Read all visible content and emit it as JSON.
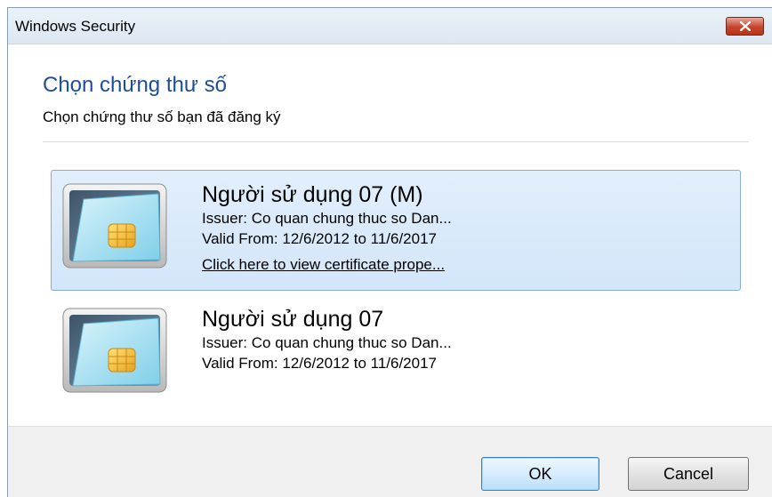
{
  "window": {
    "title": "Windows Security",
    "close_icon": "close-x-icon"
  },
  "dialog": {
    "heading": "Chọn chứng thư số",
    "subheading": "Chọn chứng thư số bạn đã đăng ký"
  },
  "certificates": [
    {
      "name": "Người sử dụng 07 (M)",
      "issuer": "Issuer: Co quan chung thuc so Dan...",
      "valid": "Valid From: 12/6/2012 to 11/6/2017",
      "link": "Click here to view certificate prope...",
      "selected": true,
      "icon": "smart-card-icon"
    },
    {
      "name": "Người sử dụng 07",
      "issuer": "Issuer: Co quan chung thuc so Dan...",
      "valid": "Valid From: 12/6/2012 to 11/6/2017",
      "selected": false,
      "icon": "smart-card-icon"
    }
  ],
  "buttons": {
    "ok": "OK",
    "cancel": "Cancel"
  },
  "colors": {
    "heading": "#1e4d9b",
    "selection_bg": "#d3e6fa",
    "selection_border": "#84acdd",
    "close_button": "#c7432b"
  }
}
